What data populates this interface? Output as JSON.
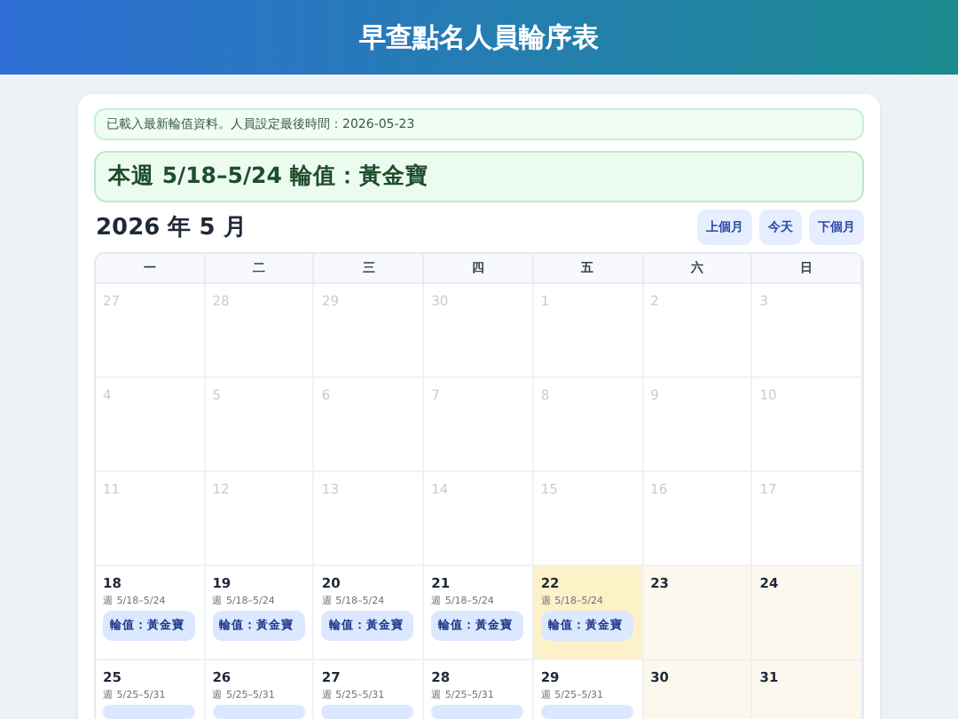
{
  "header": {
    "title": "早查點名人員輪序表"
  },
  "notice": "已載入最新輪值資料。人員設定最後時間：2026-05-23",
  "banner": "本週 5/18–5/24 輪值：黃金寶",
  "month": "2026 年 5 月",
  "nav_buttons": [
    "上個月",
    "今天",
    "下個月"
  ],
  "weekdays": [
    "一",
    "二",
    "三",
    "四",
    "五",
    "六",
    "日"
  ],
  "weeks": [
    [
      {
        "day": "27",
        "faded": true
      },
      {
        "day": "28",
        "faded": true
      },
      {
        "day": "29",
        "faded": true
      },
      {
        "day": "30",
        "faded": true
      },
      {
        "day": "1",
        "faded": true
      },
      {
        "day": "2",
        "faded": true
      },
      {
        "day": "3",
        "faded": true
      }
    ],
    [
      {
        "day": "4",
        "faded": true
      },
      {
        "day": "5",
        "faded": true
      },
      {
        "day": "6",
        "faded": true
      },
      {
        "day": "7",
        "faded": true
      },
      {
        "day": "8",
        "faded": true
      },
      {
        "day": "9",
        "faded": true
      },
      {
        "day": "10",
        "faded": true
      }
    ],
    [
      {
        "day": "11",
        "faded": true
      },
      {
        "day": "12",
        "faded": true
      },
      {
        "day": "13",
        "faded": true
      },
      {
        "day": "14",
        "faded": true
      },
      {
        "day": "15",
        "faded": true
      },
      {
        "day": "16",
        "faded": true
      },
      {
        "day": "17",
        "faded": true
      }
    ],
    [
      {
        "day": "18",
        "week": "週 5/18–5/24",
        "duty": "輪值：黃金寶"
      },
      {
        "day": "19",
        "week": "週 5/18–5/24",
        "duty": "輪值：黃金寶"
      },
      {
        "day": "20",
        "week": "週 5/18–5/24",
        "duty": "輪值：黃金寶"
      },
      {
        "day": "21",
        "week": "週 5/18–5/24",
        "duty": "輪值：黃金寶"
      },
      {
        "day": "22",
        "week": "週 5/18–5/24",
        "duty": "輪值：黃金寶",
        "today": true
      },
      {
        "day": "23",
        "weekend": true
      },
      {
        "day": "24",
        "weekend": true
      }
    ],
    [
      {
        "day": "25",
        "week": "週 5/25–5/31",
        "chip": true
      },
      {
        "day": "26",
        "week": "週 5/25–5/31",
        "chip": true
      },
      {
        "day": "27",
        "week": "週 5/25–5/31",
        "chip": true
      },
      {
        "day": "28",
        "week": "週 5/25–5/31",
        "chip": true
      },
      {
        "day": "29",
        "week": "週 5/25–5/31",
        "chip": true
      },
      {
        "day": "30",
        "weekend": true
      },
      {
        "day": "31",
        "weekend": true
      }
    ]
  ]
}
